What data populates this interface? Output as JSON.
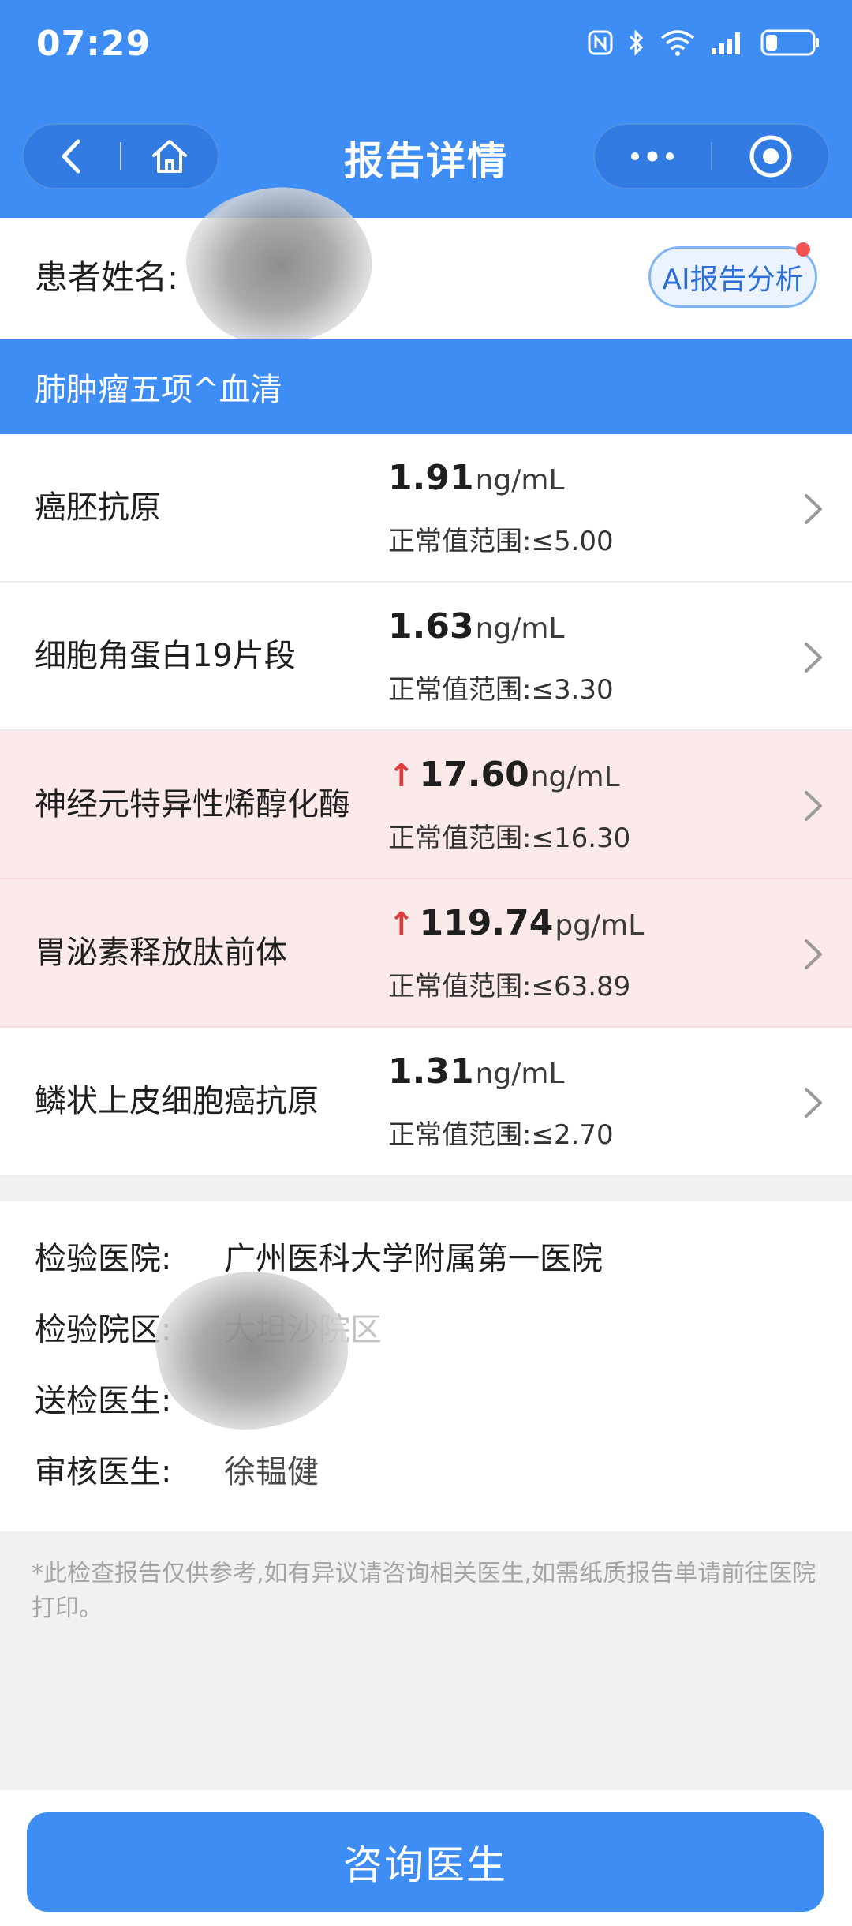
{
  "status_bar": {
    "time": "07:29"
  },
  "nav": {
    "title": "报告详情",
    "back_icon": "chevron-left-icon",
    "home_icon": "home-icon",
    "more_icon": "more-dots-icon",
    "target_icon": "record-target-icon"
  },
  "patient": {
    "label": "患者姓名:",
    "ai_button": "AI报告分析"
  },
  "section": {
    "title": "肺肿瘤五项^血清"
  },
  "results": [
    {
      "name": "癌胚抗原",
      "value": "1.91",
      "unit": "ng/mL",
      "range": "正常值范围:≤5.00",
      "abnormal": false
    },
    {
      "name": "细胞角蛋白19片段",
      "value": "1.63",
      "unit": "ng/mL",
      "range": "正常值范围:≤3.30",
      "abnormal": false
    },
    {
      "name": "神经元特异性烯醇化酶",
      "value": "17.60",
      "unit": "ng/mL",
      "range": "正常值范围:≤16.30",
      "abnormal": true
    },
    {
      "name": "胃泌素释放肽前体",
      "value": "119.74",
      "unit": "pg/mL",
      "range": "正常值范围:≤63.89",
      "abnormal": true
    },
    {
      "name": "鳞状上皮细胞癌抗原",
      "value": "1.31",
      "unit": "ng/mL",
      "range": "正常值范围:≤2.70",
      "abnormal": false
    }
  ],
  "info": {
    "hospital_label": "检验医院:",
    "hospital_value": "广州医科大学附属第一医院",
    "campus_label": "检验院区:",
    "campus_value": "大坦沙院区",
    "sender_label": "送检医生:",
    "reviewer_label": "审核医生:",
    "reviewer_value": "徐韫健"
  },
  "disclaimer": "*此检查报告仅供参考,如有异议请咨询相关医生,如需纸质报告单请前往医院打印。",
  "consult_button": "咨询医生",
  "colors": {
    "primary": "#3d8df5",
    "abnormal_bg": "#fce9ea",
    "up_arrow": "#e03a3a"
  }
}
